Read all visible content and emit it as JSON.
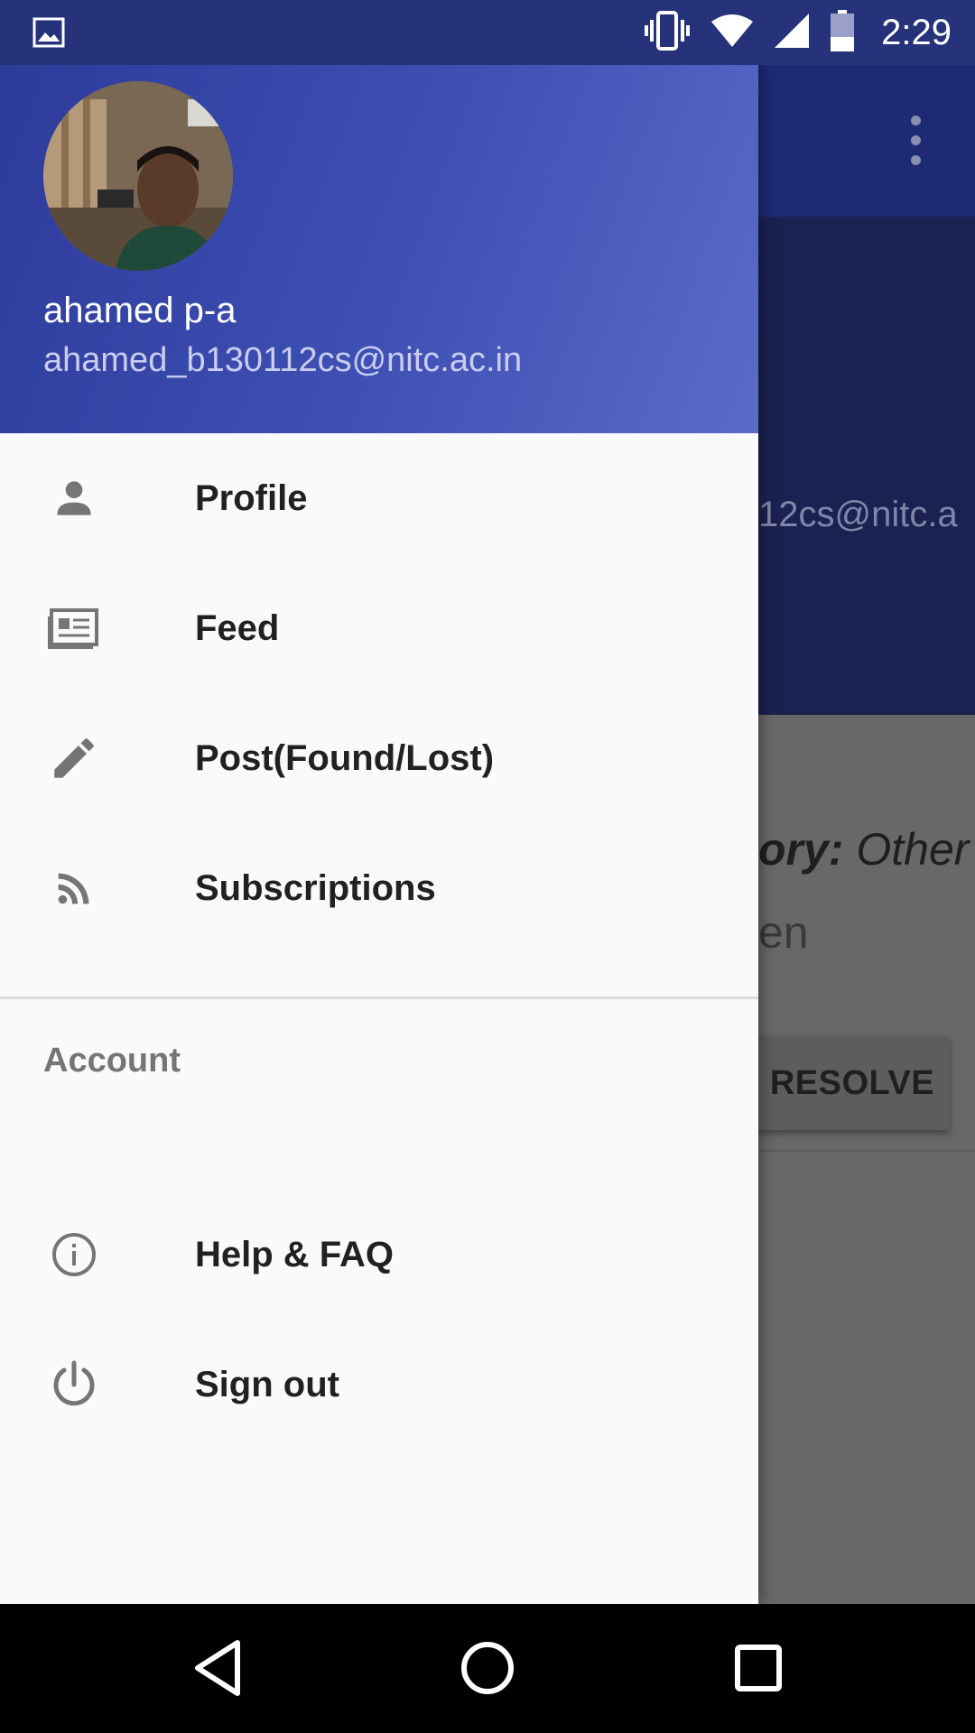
{
  "status_bar": {
    "time": "2:29",
    "icons": [
      "image-notification-icon",
      "vibrate-icon",
      "wifi-icon",
      "signal-icon",
      "battery-icon"
    ]
  },
  "background_app": {
    "email_partial": "12cs@nitc.a",
    "category_label": "ory:",
    "category_value": "Other",
    "status_partial": "en",
    "resolve_button": "RESOLVE"
  },
  "drawer": {
    "header": {
      "user_name": "ahamed p-a",
      "user_email": "ahamed_b130112cs@nitc.ac.in"
    },
    "items": [
      {
        "label": "Profile",
        "icon": "person-icon"
      },
      {
        "label": "Feed",
        "icon": "newspaper-icon"
      },
      {
        "label": "Post(Found/Lost)",
        "icon": "pencil-icon"
      },
      {
        "label": "Subscriptions",
        "icon": "rss-icon"
      }
    ],
    "account_section": {
      "title": "Account",
      "items": [
        {
          "label": "Help & FAQ",
          "icon": "info-icon"
        },
        {
          "label": "Sign out",
          "icon": "power-icon"
        }
      ]
    }
  },
  "colors": {
    "header_primary": "#3f51b5",
    "drawer_background": "#fafafa",
    "menu_text": "#212121",
    "icon_gray": "#757575"
  },
  "nav_bar": {
    "buttons": [
      "back-icon",
      "home-icon",
      "recents-icon"
    ]
  }
}
